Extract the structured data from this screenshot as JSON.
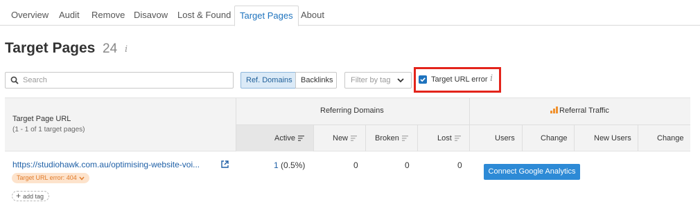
{
  "tabs": [
    {
      "label": "Overview"
    },
    {
      "label": "Audit"
    },
    {
      "label": "Remove"
    },
    {
      "label": "Disavow"
    },
    {
      "label": "Lost & Found"
    },
    {
      "label": "Target Pages",
      "active": true
    },
    {
      "label": "About"
    }
  ],
  "header": {
    "title": "Target Pages",
    "count": "24",
    "info_glyph": "i"
  },
  "toolbar": {
    "search_placeholder": "Search",
    "segment_ref": "Ref. Domains",
    "segment_backlinks": "Backlinks",
    "tag_filter": "Filter by tag",
    "url_error_label": "Target URL error",
    "url_error_checked": true
  },
  "table": {
    "col_url": "Target Page URL",
    "col_url_sub": "(1 - 1 of 1 target pages)",
    "group_referring": "Referring Domains",
    "group_traffic": "Referral Traffic",
    "cols_referring": [
      "Active",
      "New",
      "Broken",
      "Lost"
    ],
    "cols_traffic": [
      "Users",
      "Change",
      "New Users",
      "Change"
    ],
    "row": {
      "url": "https://studiohawk.com.au/optimising-website-voi...",
      "error_badge": "Target URL error: 404",
      "add_tag": "add tag",
      "active_count": "1",
      "active_pct": "(0.5%)",
      "new": "0",
      "broken": "0",
      "lost": "0",
      "connect_button": "Connect Google Analytics"
    }
  },
  "colors": {
    "accent": "#1e73be",
    "error_outline": "#e3241b",
    "badge_bg": "#fde3cc",
    "badge_text": "#e07b2a",
    "ga_button": "#2d8ad6",
    "traffic_icon": "#f0922f"
  }
}
